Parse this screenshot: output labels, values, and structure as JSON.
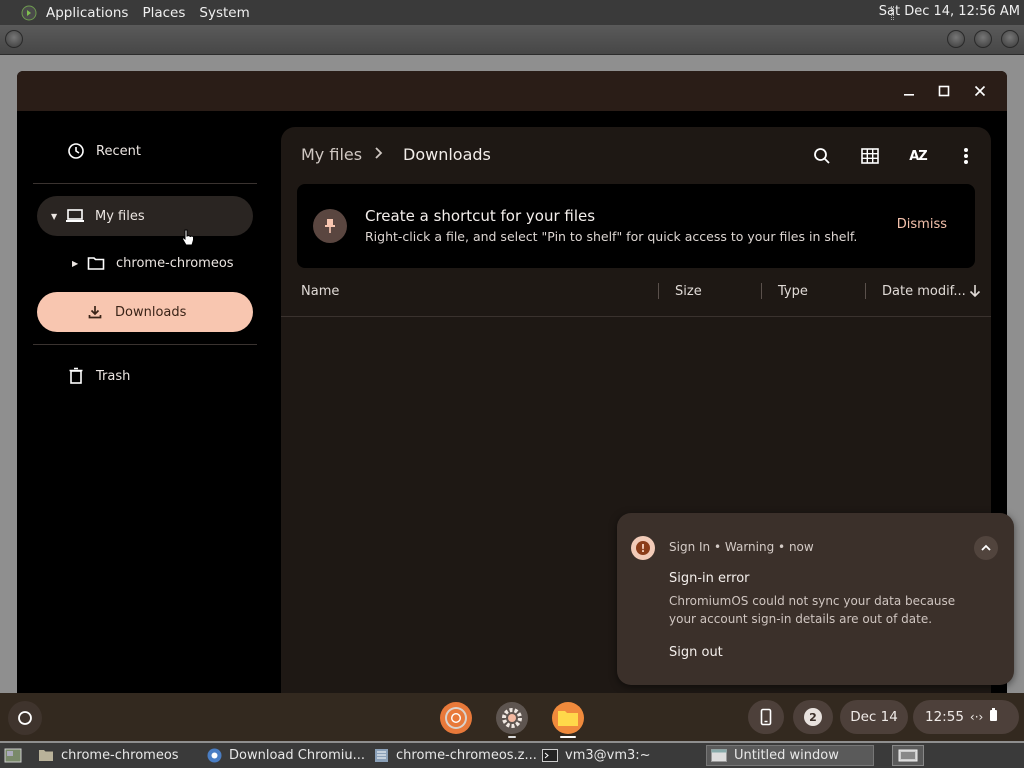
{
  "top_panel": {
    "menu": [
      "Applications",
      "Places",
      "System"
    ],
    "clock": "Sat Dec 14, 12:56 AM"
  },
  "sidebar": {
    "recent": "Recent",
    "my_files": "My files",
    "chrome_folder": "chrome-chromeos",
    "downloads": "Downloads",
    "trash": "Trash"
  },
  "breadcrumb": {
    "root": "My files",
    "current": "Downloads"
  },
  "toolbar": {
    "search": "search-icon",
    "grid": "grid-view-icon",
    "sort": "AZ",
    "more": "more-vert-icon"
  },
  "banner": {
    "title": "Create a shortcut for your files",
    "subtitle": "Right-click a file, and select \"Pin to shelf\" for quick access to your files in shelf.",
    "dismiss": "Dismiss"
  },
  "columns": {
    "name": "Name",
    "size": "Size",
    "type": "Type",
    "date": "Date modif..."
  },
  "notification": {
    "source": "Sign In",
    "level": "Warning",
    "time": "now",
    "title": "Sign-in error",
    "body": "ChromiumOS could not sync your data because your account sign-in details are out of date.",
    "action": "Sign out"
  },
  "shelf": {
    "badge_count": "2",
    "date": "Dec 14",
    "time": "12:55"
  },
  "taskbar": {
    "items": [
      "chrome-chromeos",
      "Download Chromiu...",
      "chrome-chromeos.z...",
      "vm3@vm3:~",
      "Untitled window"
    ]
  },
  "colors": {
    "accent": "#f8c6b0",
    "accent_text": "#3a2418",
    "panel_bg": "#1e1814",
    "notification_bg": "#3b302a"
  }
}
